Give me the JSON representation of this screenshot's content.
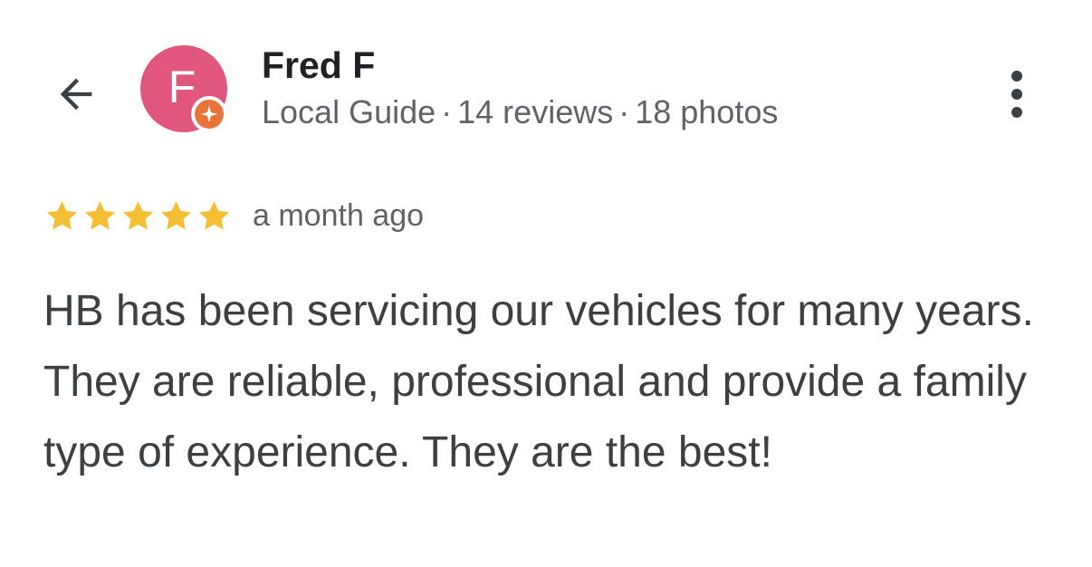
{
  "header": {
    "back_icon": "arrow-left-icon",
    "more_icon": "more-vert-icon"
  },
  "reviewer": {
    "avatar_letter": "F",
    "avatar_color": "#e1567c",
    "badge_icon": "local-guide-badge-icon",
    "badge_color": "#e8743a",
    "name": "Fred F",
    "level": "Local Guide",
    "separator": "·",
    "reviews": "14 reviews",
    "photos": "18 photos"
  },
  "rating": {
    "stars": 5,
    "max_stars": 5,
    "star_color": "#f4be35",
    "date": "a month ago"
  },
  "review": {
    "text": "HB has been servicing our vehicles for many years. They are reliable, professional and provide a family type of experience. They are the best!"
  }
}
